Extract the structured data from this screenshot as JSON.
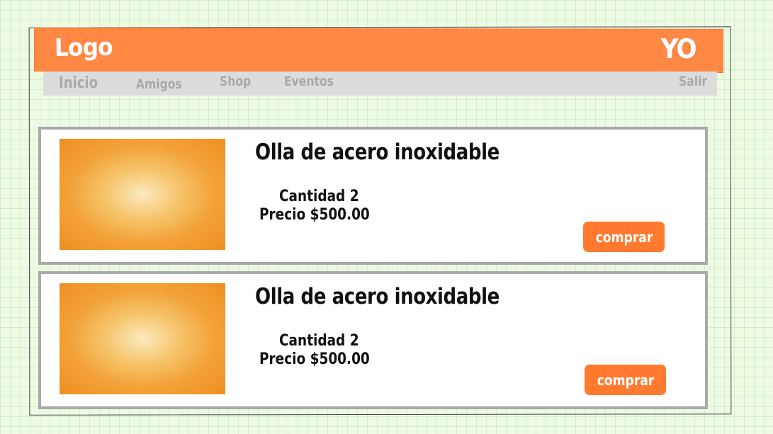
{
  "header": {
    "logo": "Logo",
    "user": "YO"
  },
  "nav": {
    "items": [
      {
        "label": "Inicio"
      },
      {
        "label": "Amigos"
      },
      {
        "label": "Shop"
      },
      {
        "label": "Eventos"
      }
    ],
    "logout": "Salir"
  },
  "products": [
    {
      "title": "Olla  de acero inoxidable",
      "quantity": "Cantidad 2",
      "price": "Precio $500.00",
      "button": "comprar"
    },
    {
      "title": "Olla  de acero inoxidable",
      "quantity": "Cantidad 2",
      "price": "Precio $500.00",
      "button": "comprar"
    }
  ],
  "colors": {
    "accent": "#ff8844",
    "button": "#ff7a2e",
    "nav_background": "#dcdcdc",
    "nav_text": "#a9a9a9",
    "image_placeholder": "#ee8f22",
    "page_background": "#eefbe4"
  }
}
